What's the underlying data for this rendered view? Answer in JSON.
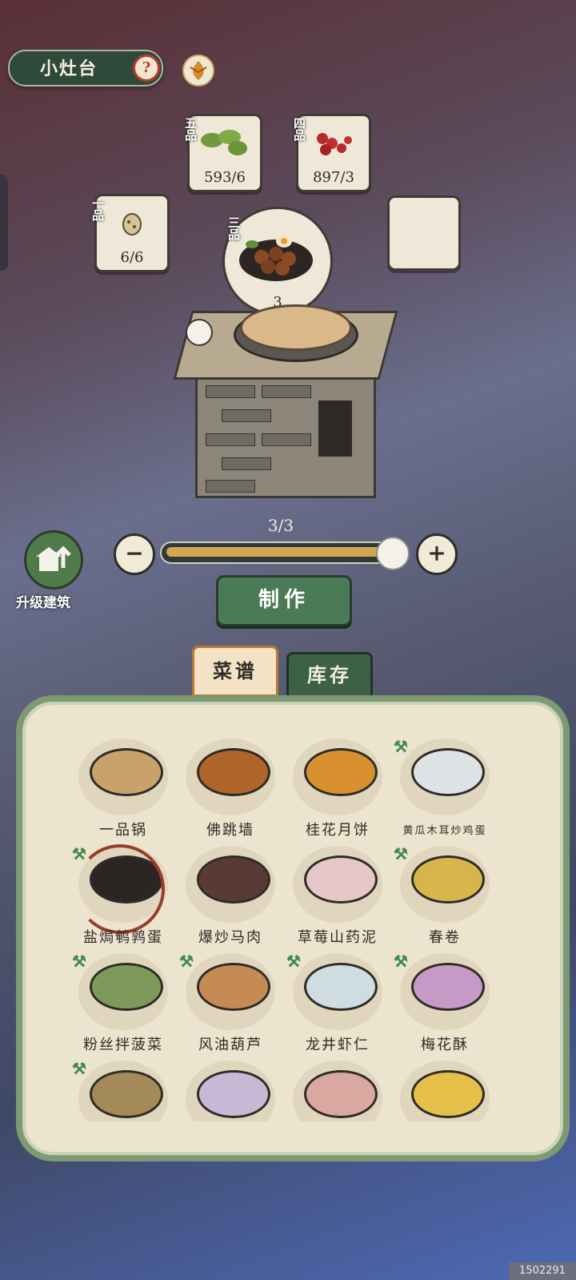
{
  "header": {
    "title": "小灶台",
    "help_label": "?"
  },
  "ingredients": [
    {
      "grade": "五品",
      "count": "593/6"
    },
    {
      "grade": "四品",
      "count": "897/3"
    },
    {
      "grade": "一品",
      "count": "6/6"
    },
    {
      "grade": "",
      "count": ""
    }
  ],
  "result": {
    "grade": "三品",
    "count": "3"
  },
  "quantity": {
    "label": "3/3",
    "minus": "−",
    "plus": "+",
    "fill_fraction": 1.0
  },
  "upgrade": {
    "label": "升级建筑"
  },
  "actions": {
    "make_label": "制作"
  },
  "tabs": {
    "recipes": "菜谱",
    "inventory": "库存"
  },
  "recipes": [
    {
      "name": "一品锅",
      "color": "#c9a26b"
    },
    {
      "name": "佛跳墙",
      "color": "#b0652a"
    },
    {
      "name": "桂花月饼",
      "color": "#d8912e"
    },
    {
      "name": "黄瓜木耳炒鸡蛋",
      "color": "#dfe3e6"
    },
    {
      "name": "盐焗鹌鹑蛋",
      "color": "#2b2623"
    },
    {
      "name": "爆炒马肉",
      "color": "#5a3a36"
    },
    {
      "name": "草莓山药泥",
      "color": "#e6c7c7"
    },
    {
      "name": "春卷",
      "color": "#d8b54a"
    },
    {
      "name": "粉丝拌菠菜",
      "color": "#7d9a5a"
    },
    {
      "name": "风油葫芦",
      "color": "#c68b55"
    },
    {
      "name": "龙井虾仁",
      "color": "#cfdce0"
    },
    {
      "name": "梅花酥",
      "color": "#c89ac8"
    },
    {
      "name": "",
      "color": "#a38a58"
    },
    {
      "name": "",
      "color": "#c9b7d6"
    },
    {
      "name": "",
      "color": "#d9a8a0"
    },
    {
      "name": "",
      "color": "#e6c04a"
    }
  ],
  "watermark": "1502291"
}
